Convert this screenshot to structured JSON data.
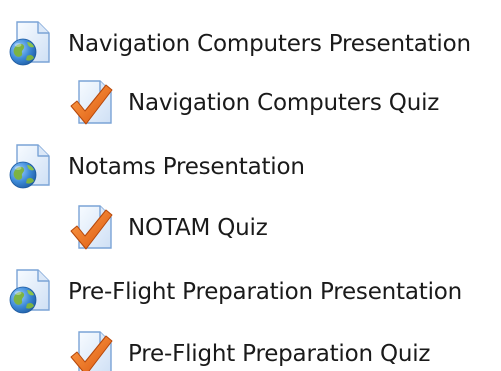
{
  "activities": [
    {
      "type": "presentation",
      "icon": "globe-document-icon",
      "label": "Navigation Computers Presentation"
    },
    {
      "type": "quiz",
      "icon": "quiz-checkmark-icon",
      "label": "Navigation Computers Quiz"
    },
    {
      "type": "presentation",
      "icon": "globe-document-icon",
      "label": "Notams Presentation"
    },
    {
      "type": "quiz",
      "icon": "quiz-checkmark-icon",
      "label": "NOTAM Quiz"
    },
    {
      "type": "presentation",
      "icon": "globe-document-icon",
      "label": "Pre-Flight Preparation Presentation"
    },
    {
      "type": "quiz",
      "icon": "quiz-checkmark-icon",
      "label": "Pre-Flight Preparation Quiz"
    }
  ],
  "colors": {
    "text": "#1a1a1a",
    "document": "#e6f0fb",
    "document_border": "#7aa3d6",
    "globe": "#2f78c4",
    "land": "#7cb342",
    "check": "#e8701a"
  }
}
